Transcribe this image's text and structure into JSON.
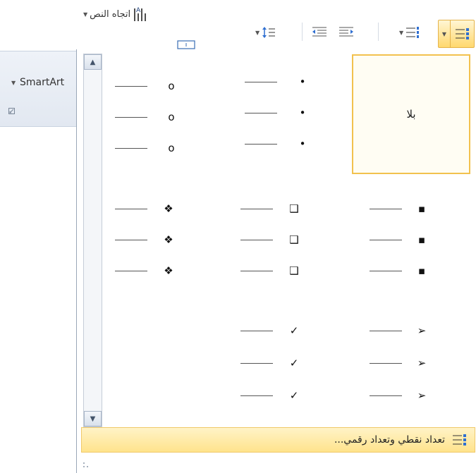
{
  "ribbon": {
    "text_direction_label": "اتجاه النص",
    "smartart_label": "SmartArt",
    "accent_color": "#f2c14e"
  },
  "gallery": {
    "none_label": "بلا",
    "rows": [
      {
        "cells": [
          "none",
          "small-dot",
          "hollow-circle"
        ]
      },
      {
        "cells": [
          "black-square",
          "hollow-square",
          "four-diamond"
        ]
      },
      {
        "cells": [
          "arrowhead",
          "check-mark",
          ""
        ]
      }
    ],
    "icons": {
      "small-dot": "•",
      "hollow-circle": "o",
      "black-square": "▪",
      "hollow-square": "❑",
      "four-diamond": "❖",
      "arrowhead": "➢",
      "check-mark": "✓"
    },
    "footer_label": "تعداد نقطي وتعداد رقمي..."
  }
}
